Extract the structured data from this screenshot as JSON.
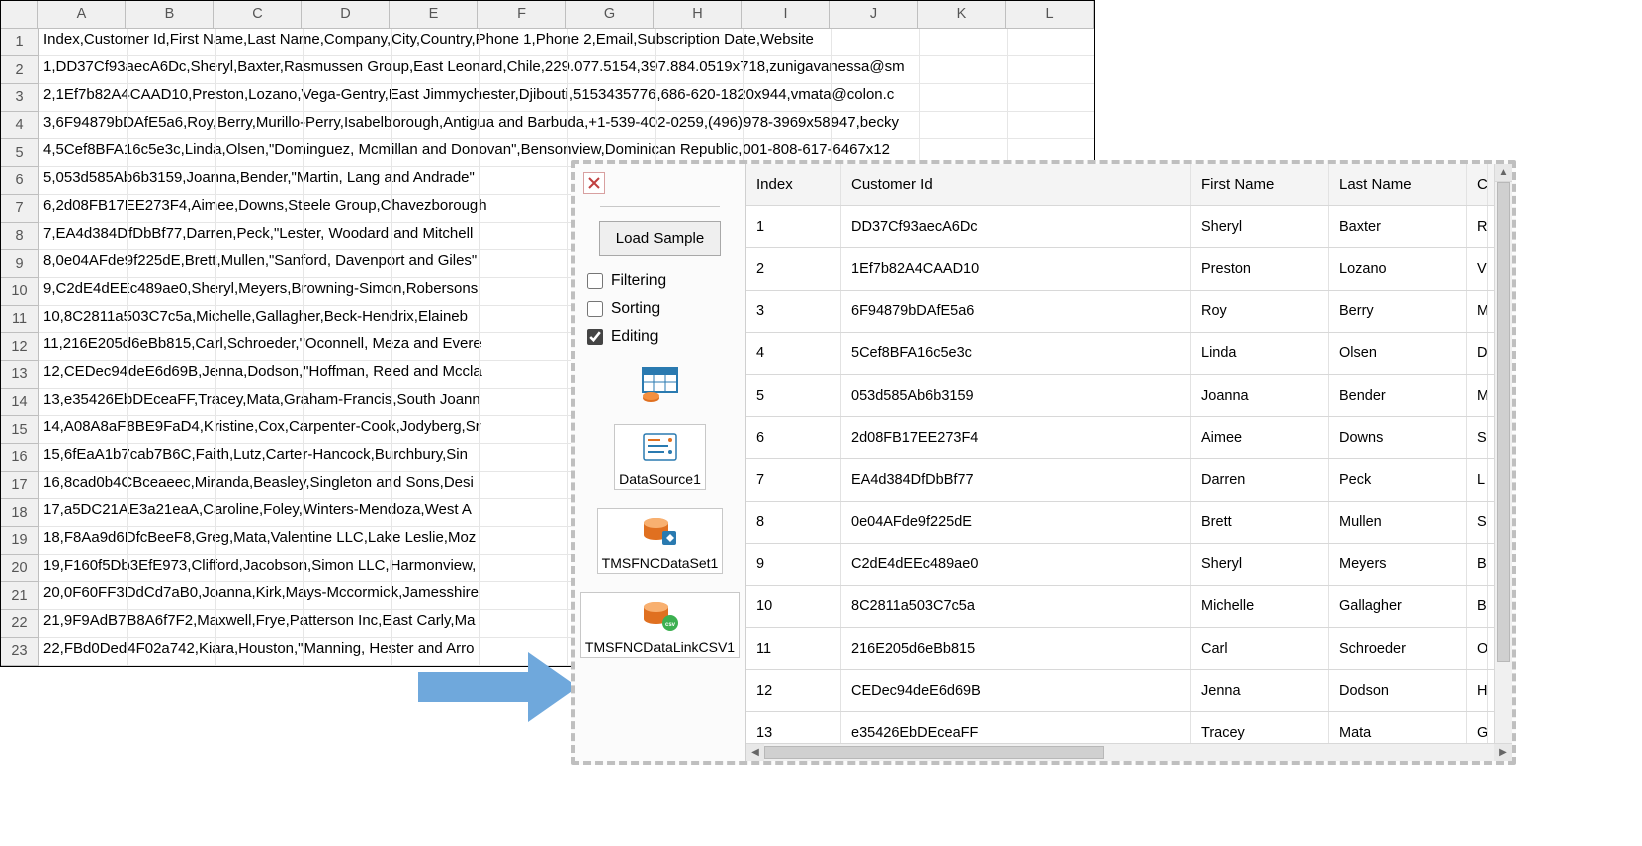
{
  "spreadsheet": {
    "columns": [
      "A",
      "B",
      "C",
      "D",
      "E",
      "F",
      "G",
      "H",
      "I",
      "J",
      "K",
      "L"
    ],
    "rows": [
      "Index,Customer Id,First Name,Last Name,Company,City,Country,Phone 1,Phone 2,Email,Subscription Date,Website",
      "1,DD37Cf93aecA6Dc,Sheryl,Baxter,Rasmussen Group,East Leonard,Chile,229.077.5154,397.884.0519x718,zunigavanessa@sm",
      "2,1Ef7b82A4CAAD10,Preston,Lozano,Vega-Gentry,East Jimmychester,Djibouti,5153435776,686-620-1820x944,vmata@colon.c",
      "3,6F94879bDAfE5a6,Roy,Berry,Murillo-Perry,Isabelborough,Antigua and Barbuda,+1-539-402-0259,(496)978-3969x58947,becky",
      "4,5Cef8BFA16c5e3c,Linda,Olsen,\"Dominguez, Mcmillan and Donovan\",Bensonview,Dominican Republic,001-808-617-6467x12",
      "5,053d585Ab6b3159,Joanna,Bender,\"Martin, Lang and Andrade\"",
      "6,2d08FB17EE273F4,Aimee,Downs,Steele Group,Chavezborough",
      "7,EA4d384DfDbBf77,Darren,Peck,\"Lester, Woodard and Mitchell",
      "8,0e04AFde9f225dE,Brett,Mullen,\"Sanford, Davenport and Giles\"",
      "9,C2dE4dEEc489ae0,Sheryl,Meyers,Browning-Simon,Robersons",
      "10,8C2811a503C7c5a,Michelle,Gallagher,Beck-Hendrix,Elaineb",
      "11,216E205d6eBb815,Carl,Schroeder,\"Oconnell, Meza and Evere",
      "12,CEDec94deE6d69B,Jenna,Dodson,\"Hoffman, Reed and Mccla",
      "13,e35426EbDEceaFF,Tracey,Mata,Graham-Francis,South Joann",
      "14,A08A8aF8BE9FaD4,Kristine,Cox,Carpenter-Cook,Jodyberg,Sr",
      "15,6fEaA1b7cab7B6C,Faith,Lutz,Carter-Hancock,Burchbury,Sin",
      "16,8cad0b4CBceaeec,Miranda,Beasley,Singleton and Sons,Desi",
      "17,a5DC21AE3a21eaA,Caroline,Foley,Winters-Mendoza,West A",
      "18,F8Aa9d6DfcBeeF8,Greg,Mata,Valentine LLC,Lake Leslie,Moz",
      "19,F160f5Db3EfE973,Clifford,Jacobson,Simon LLC,Harmonview,",
      "20,0F60FF3DdCd7aB0,Joanna,Kirk,Mays-Mccormick,Jamesshire",
      "21,9F9AdB7B8A6f7F2,Maxwell,Frye,Patterson Inc,East Carly,Ma",
      "22,FBd0Ded4F02a742,Kiara,Houston,\"Manning, Hester and Arro"
    ]
  },
  "panel": {
    "load_button": "Load Sample",
    "checks": {
      "filtering": "Filtering",
      "sorting": "Sorting",
      "editing": "Editing"
    },
    "components": {
      "datasource": "DataSource1",
      "dataset": "TMSFNCDataSet1",
      "datalink": "TMSFNCDataLinkCSV1"
    },
    "grid": {
      "headers": {
        "index": "Index",
        "customer_id": "Customer Id",
        "first_name": "First Name",
        "last_name": "Last Name",
        "cut": "C"
      },
      "rows": [
        {
          "index": "1",
          "cid": "DD37Cf93aecA6Dc",
          "fn": "Sheryl",
          "ln": "Baxter",
          "cut": "R"
        },
        {
          "index": "2",
          "cid": "1Ef7b82A4CAAD10",
          "fn": "Preston",
          "ln": "Lozano",
          "cut": "V"
        },
        {
          "index": "3",
          "cid": "6F94879bDAfE5a6",
          "fn": "Roy",
          "ln": "Berry",
          "cut": "M"
        },
        {
          "index": "4",
          "cid": "5Cef8BFA16c5e3c",
          "fn": "Linda",
          "ln": "Olsen",
          "cut": "D"
        },
        {
          "index": "5",
          "cid": "053d585Ab6b3159",
          "fn": "Joanna",
          "ln": "Bender",
          "cut": "M"
        },
        {
          "index": "6",
          "cid": "2d08FB17EE273F4",
          "fn": "Aimee",
          "ln": "Downs",
          "cut": "S"
        },
        {
          "index": "7",
          "cid": "EA4d384DfDbBf77",
          "fn": "Darren",
          "ln": "Peck",
          "cut": "L"
        },
        {
          "index": "8",
          "cid": "0e04AFde9f225dE",
          "fn": "Brett",
          "ln": "Mullen",
          "cut": "S"
        },
        {
          "index": "9",
          "cid": "C2dE4dEEc489ae0",
          "fn": "Sheryl",
          "ln": "Meyers",
          "cut": "B"
        },
        {
          "index": "10",
          "cid": "8C2811a503C7c5a",
          "fn": "Michelle",
          "ln": "Gallagher",
          "cut": "B"
        },
        {
          "index": "11",
          "cid": "216E205d6eBb815",
          "fn": "Carl",
          "ln": "Schroeder",
          "cut": "O"
        },
        {
          "index": "12",
          "cid": "CEDec94deE6d69B",
          "fn": "Jenna",
          "ln": "Dodson",
          "cut": "H"
        },
        {
          "index": "13",
          "cid": "e35426EbDEceaFF",
          "fn": "Tracey",
          "ln": "Mata",
          "cut": "G"
        }
      ]
    }
  }
}
